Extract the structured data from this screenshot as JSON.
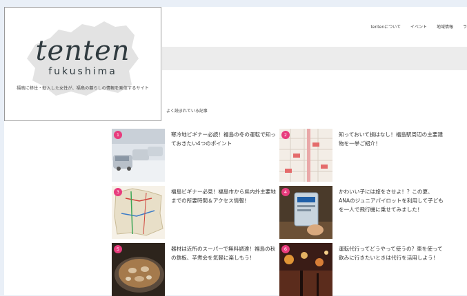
{
  "nav": {
    "items": [
      "tentenについて",
      "イベント",
      "地域情報",
      "ラ"
    ]
  },
  "logo": {
    "script": "tenten",
    "sub": "fukushima",
    "tagline": "福島に移住・転入した女性が、福島の暮らしの情報を発信するサイト"
  },
  "ranking": {
    "label": "よく読まれている記事",
    "items": [
      {
        "rank": "1",
        "title": "寒冷地ビギナー必読！福島の冬の運転で知っておきたい4つのポイント"
      },
      {
        "rank": "2",
        "title": "知っておいて損はなし！福島駅周辺の主要建物を一挙ご紹介！"
      },
      {
        "rank": "3",
        "title": "福島ビギナー必見！福島市から県内外主要地までの所要時間＆アクセス情報！"
      },
      {
        "rank": "4",
        "title": "かわいい子には旅をさせよ！？この夏、ANAのジュニアパイロットを利用して子どもを一人で飛行機に乗せてみました！"
      },
      {
        "rank": "5",
        "title": "器材は近所のスーパーで無料調達！福島の秋の鉄板、芋煮会を気軽に楽しもう！"
      },
      {
        "rank": "6",
        "title": "運転代行ってどうやって使うの？車を使って飲みに行きたいときは代行を活用しよう！"
      }
    ]
  },
  "colors": {
    "badge": "#e83c7d",
    "background": "#e9eff7"
  }
}
